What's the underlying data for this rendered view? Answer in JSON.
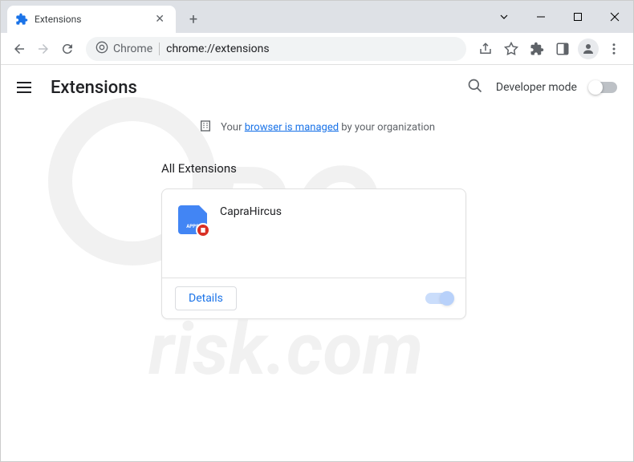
{
  "tab": {
    "title": "Extensions"
  },
  "omnibox": {
    "prefix": "Chrome",
    "url": "chrome://extensions"
  },
  "page": {
    "title": "Extensions"
  },
  "header": {
    "devmode": "Developer mode"
  },
  "managed": {
    "before": "Your ",
    "link": "browser is managed",
    "after": " by your organization"
  },
  "section": {
    "title": "All Extensions"
  },
  "extension": {
    "name": "CapraHircus",
    "details": "Details"
  }
}
